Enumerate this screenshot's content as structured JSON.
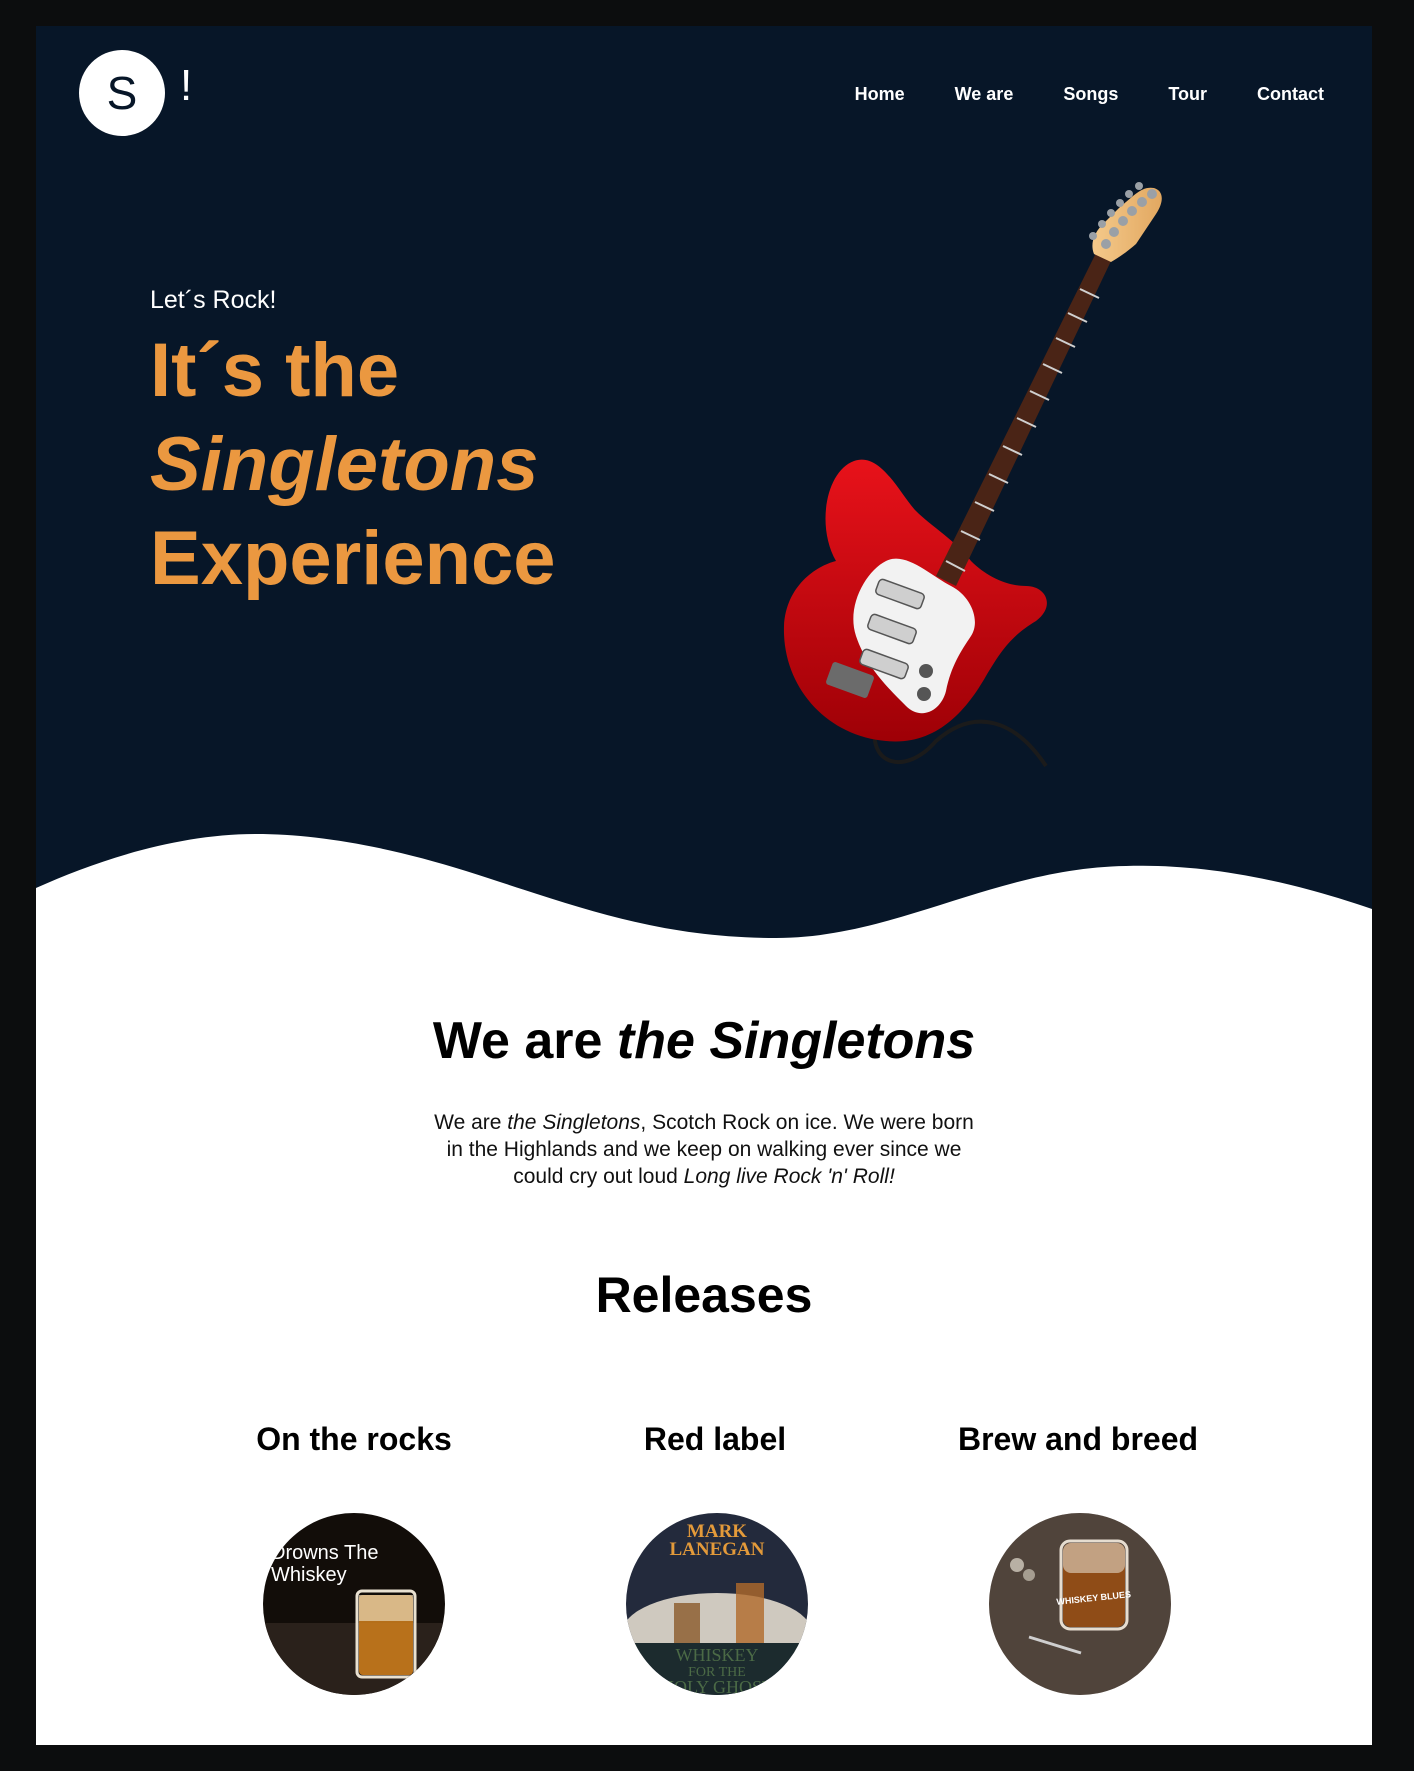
{
  "nav": {
    "logo_letter": "S",
    "logo_mark": "!",
    "items": [
      "Home",
      "We are",
      "Songs",
      "Tour",
      "Contact"
    ]
  },
  "hero": {
    "kicker": "Let´s Rock!",
    "line1": "It´s the",
    "line2": "Singletons",
    "line3": "Experience",
    "accent_color": "#eb9840",
    "background_color": "#071628"
  },
  "about": {
    "title_plain": "We are ",
    "title_italic": "the Singletons",
    "text_1": "We are ",
    "text_italic_1": "the Singletons",
    "text_2": ", Scotch Rock on ice. We were born in the Highlands and we keep on walking ever since we could cry out loud ",
    "text_italic_2": "Long live Rock 'n' Roll!"
  },
  "releases": {
    "title": "Releases",
    "items": [
      {
        "name": "On the rocks",
        "cover_text_1": "Drowns The",
        "cover_text_2": "Whiskey"
      },
      {
        "name": "Red label",
        "cover_text_1": "MARK",
        "cover_text_2": "LANEGAN",
        "cover_text_3": "WHISKEY",
        "cover_text_4": "FOR THE",
        "cover_text_5": "HOLY GHOST"
      },
      {
        "name": "Brew and breed",
        "cover_text_1": "WHISKEY BLUES"
      }
    ]
  }
}
